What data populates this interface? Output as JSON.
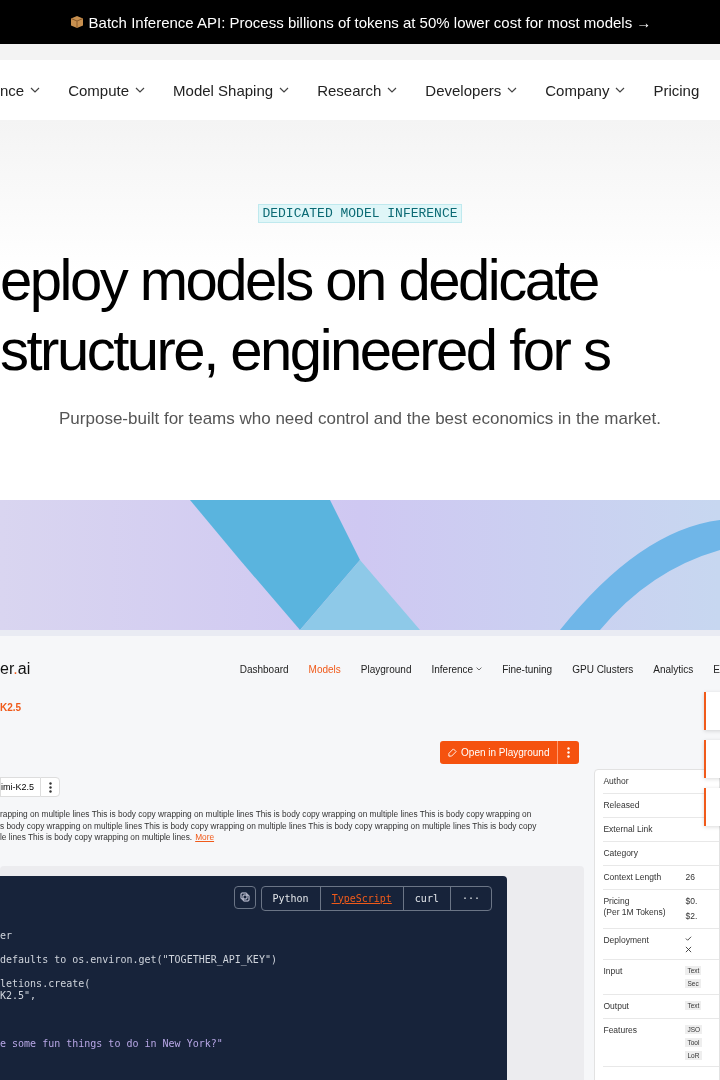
{
  "banner": {
    "text": "Batch Inference API: Process billions of tokens at 50% lower cost for most models →"
  },
  "nav": {
    "items": [
      {
        "label": "nce",
        "caret": true
      },
      {
        "label": "Compute",
        "caret": true
      },
      {
        "label": "Model Shaping",
        "caret": true
      },
      {
        "label": "Research",
        "caret": true
      },
      {
        "label": "Developers",
        "caret": true
      },
      {
        "label": "Company",
        "caret": true
      },
      {
        "label": "Pricing",
        "caret": false
      }
    ]
  },
  "hero": {
    "eyebrow": "DEDICATED MODEL INFERENCE",
    "headline": [
      "eploy models on dedicate",
      "structure, engineered for s"
    ],
    "subtitle": "Purpose-built for teams who need control and the best economics in the market."
  },
  "app": {
    "logo_prefix": "er",
    "logo_dot": ".",
    "logo_suffix": "ai",
    "nav": [
      {
        "label": "Dashboard",
        "selected": false,
        "caret": false
      },
      {
        "label": "Models",
        "selected": true,
        "caret": false
      },
      {
        "label": "Playground",
        "selected": false,
        "caret": false
      },
      {
        "label": "Inference",
        "selected": false,
        "caret": true
      },
      {
        "label": "Fine-tuning",
        "selected": false,
        "caret": false
      },
      {
        "label": "GPU Clusters",
        "selected": false,
        "caret": false
      },
      {
        "label": "Analytics",
        "selected": false,
        "caret": false
      },
      {
        "label": "E",
        "selected": false,
        "caret": false
      }
    ],
    "model_title": "K2.5",
    "open_button": "Open in Playground",
    "model_chip": "imi-K2.5",
    "body_lines": [
      "rapping on multiple lines This is body copy wrapping on multiple lines This is body copy wrapping on multiple lines This is body copy wrapping on",
      "s body copy wrapping on multiple lines This is body copy wrapping on multiple lines This is body copy wrapping on multiple lines This is body copy",
      "le lines This is body copy wrapping on multiple lines."
    ],
    "more_link": "More",
    "code_tabs": [
      {
        "label": "Python",
        "selected": false
      },
      {
        "label": "TypeScript",
        "selected": true
      },
      {
        "label": "curl",
        "selected": false
      },
      {
        "label": "···",
        "selected": false
      }
    ],
    "code_lines": [
      {
        "kind": "blank"
      },
      {
        "text": "er",
        "kind": "plain"
      },
      {
        "kind": "blank"
      },
      {
        "text": "defaults to os.environ.get(\"TOGETHER_API_KEY\")",
        "kind": "plain"
      },
      {
        "kind": "blank"
      },
      {
        "text": "letions.create(",
        "kind": "plain"
      },
      {
        "text": "K2.5\",",
        "kind": "plain"
      },
      {
        "kind": "blank"
      },
      {
        "kind": "blank"
      },
      {
        "kind": "blank"
      },
      {
        "text": "e some fun things to do in New York?\"",
        "kind": "string"
      }
    ],
    "details": [
      {
        "label": "Author",
        "kind": "text"
      },
      {
        "label": "Released",
        "kind": "text"
      },
      {
        "label": "External Link",
        "kind": "text"
      },
      {
        "label": "Category",
        "kind": "text"
      },
      {
        "label": "Context Length",
        "kind": "text",
        "values": [
          "26"
        ]
      },
      {
        "label": "Pricing\n(Per 1M Tokens)",
        "kind": "text",
        "values": [
          "$0.",
          "$2."
        ]
      },
      {
        "label": "Deployment",
        "kind": "status",
        "statuses": [
          {
            "ok": true
          },
          {
            "ok": false
          }
        ]
      },
      {
        "label": "Input",
        "kind": "tags",
        "values": [
          "Text",
          "Sec"
        ]
      },
      {
        "label": "Output",
        "kind": "tags",
        "values": [
          "Text"
        ]
      },
      {
        "label": "Features",
        "kind": "tags",
        "values": [
          "JSO",
          "Tool",
          "LoR"
        ]
      }
    ]
  }
}
